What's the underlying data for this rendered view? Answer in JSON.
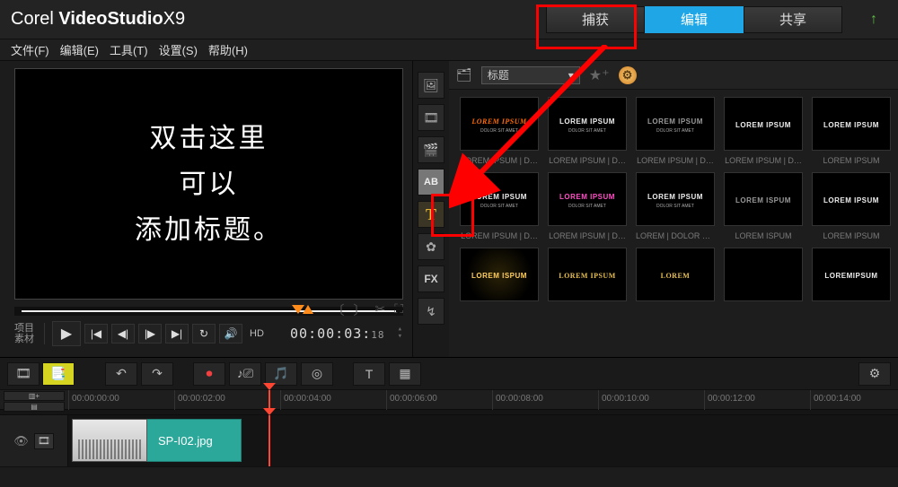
{
  "app": {
    "brand_a": "Corel",
    "brand_b": "VideoStudio",
    "brand_c": "X9"
  },
  "menus": {
    "file": "文件(F)",
    "edit": "编辑(E)",
    "tools": "工具(T)",
    "settings": "设置(S)",
    "help": "帮助(H)"
  },
  "top_tabs": {
    "capture": "捕获",
    "edit": "编辑",
    "share": "共享"
  },
  "preview": {
    "line1": "双击这里",
    "line2": "可以",
    "line3": "添加标题。"
  },
  "playbar": {
    "mode_a": "项目",
    "mode_b": "素材",
    "hd": "HD",
    "timecode": "00:00:03:",
    "frames": "18"
  },
  "library": {
    "category": "标题",
    "rows": [
      {
        "thumbs": [
          {
            "style": "tc-orange",
            "main": "LOREM IPSUM",
            "sub": "DOLOR SIT AMET"
          },
          {
            "style": "tc-plain",
            "main": "LOREM IPSUM",
            "sub": "DOLOR SIT AMET"
          },
          {
            "style": "tc-gray",
            "main": "LOREM IPSUM",
            "sub": "DOLOR SIT AMET"
          },
          {
            "style": "tc-plain",
            "main": "LOREM IPSUM",
            "sub": ""
          },
          {
            "style": "tc-plain",
            "main": "LOREM IPSUM",
            "sub": ""
          }
        ],
        "caps": [
          "LOREM IPSUM | D…",
          "LOREM IPSUM | D…",
          "LOREM IPSUM | D…",
          "LOREM IPSUM | D…",
          "LOREM IPSUM"
        ]
      },
      {
        "thumbs": [
          {
            "style": "tc-plain",
            "main": "LOREM IPSUM",
            "sub": "DOLOR SIT AMET"
          },
          {
            "style": "tc-pink",
            "main": "LOREM IPSUM",
            "sub": "DOLOR SIT AMET"
          },
          {
            "style": "tc-plain",
            "main": "LOREM IPSUM",
            "sub": "DOLOR SIT AMET"
          },
          {
            "style": "tc-gray",
            "main": "LOREM ISPUM",
            "sub": ""
          },
          {
            "style": "tc-plain",
            "main": "LOREM IPSUM",
            "sub": ""
          }
        ],
        "caps": [
          "LOREM IPSUM | D…",
          "LOREM IPSUM | D…",
          "LOREM | DOLOR S…",
          "LOREM ISPUM",
          "LOREM IPSUM"
        ]
      },
      {
        "thumbs": [
          {
            "style": "tc-glow",
            "main": "LOREM ISPUM",
            "sub": ""
          },
          {
            "style": "tc-gold",
            "main": "LOREM IPSUM",
            "sub": ""
          },
          {
            "style": "tc-gold",
            "main": "LOREM",
            "sub": ""
          },
          {
            "style": "tc-plain",
            "main": "",
            "sub": ""
          },
          {
            "style": "tc-plain",
            "main": "LOREMIPSUM",
            "sub": ""
          }
        ],
        "caps": [
          "",
          "",
          "",
          "",
          ""
        ]
      }
    ]
  },
  "ruler": [
    "00:00:00:00",
    "00:00:02:00",
    "00:00:04:00",
    "00:00:06:00",
    "00:00:08:00",
    "00:00:10:00",
    "00:00:12:00",
    "00:00:14:00"
  ],
  "clip": {
    "name": "SP-I02.jpg"
  }
}
